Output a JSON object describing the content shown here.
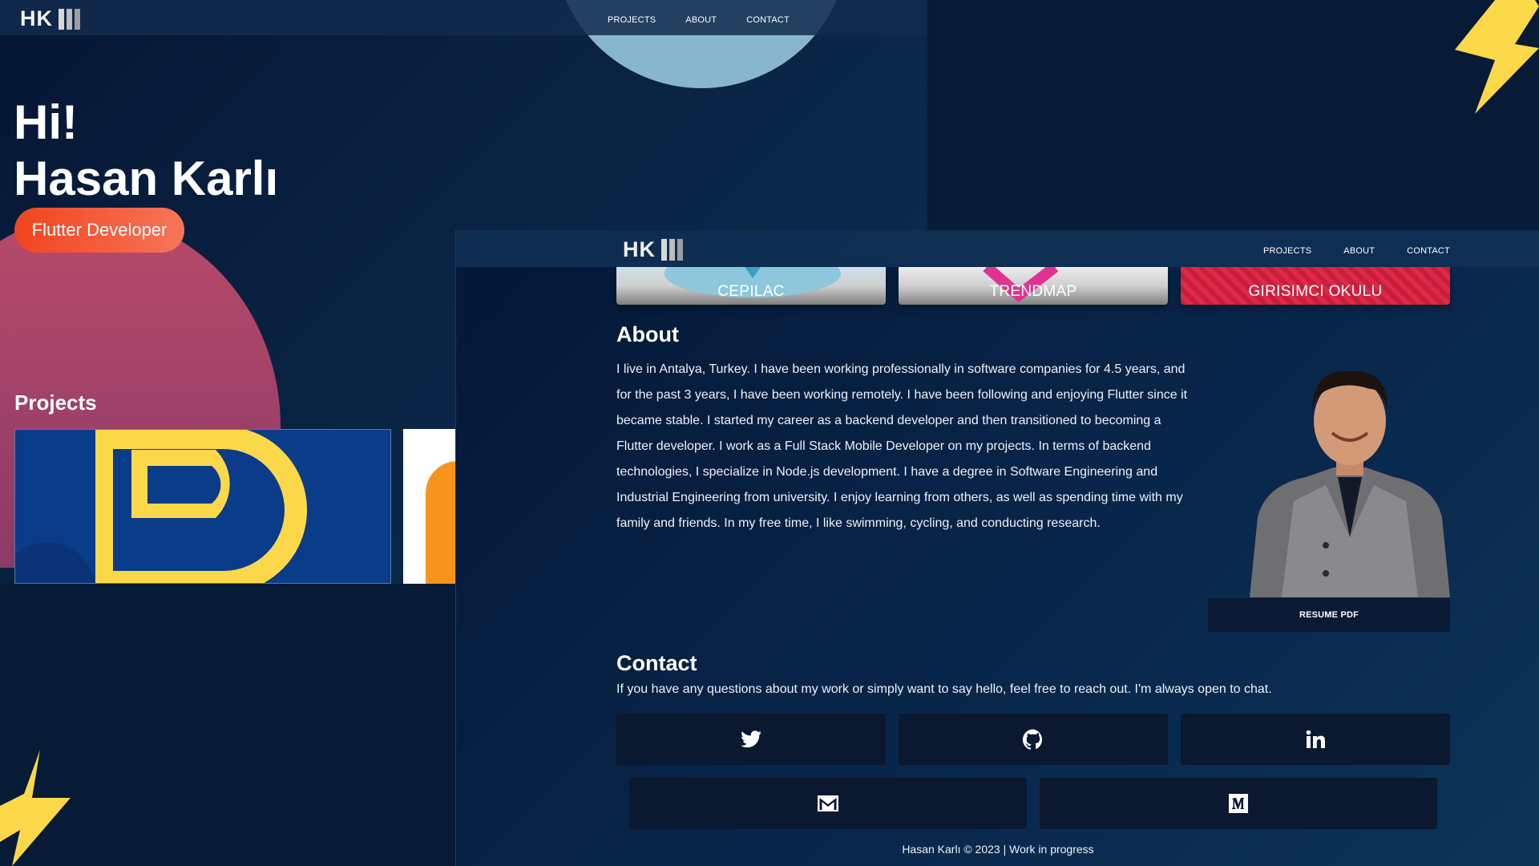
{
  "back_window": {
    "logo": {
      "text": "HK"
    },
    "nav": {
      "projects": "PROJECTS",
      "about": "ABOUT",
      "contact": "CONTACT"
    },
    "hero": {
      "greeting": "Hi!",
      "name": "Hasan Karlı",
      "role": "Flutter Developer"
    },
    "projects_heading": "Projects"
  },
  "front_window": {
    "logo": {
      "text": "HK"
    },
    "nav": {
      "projects": "PROJECTS",
      "about": "ABOUT",
      "contact": "CONTACT"
    },
    "project_cards": [
      {
        "label": "CEPILAC"
      },
      {
        "label": "TRENDMAP"
      },
      {
        "label": "GIRISIMCI OKULU"
      }
    ],
    "about": {
      "heading": "About",
      "text": "I live in Antalya, Turkey. I have been working professionally in software companies for 4.5 years, and for the past 3 years, I have been working remotely. I have been following and enjoying Flutter since it became stable. I started my career as a backend developer and then transitioned to becoming a Flutter developer. I work as a Full Stack Mobile Developer on my projects. In terms of backend technologies, I specialize in Node.js development. I have a degree in Software Engineering and Industrial Engineering from university. I enjoy learning from others, as well as spending time with my family and friends. In my free time, I like swimming, cycling, and conducting research.",
      "resume_button": "RESUME PDF"
    },
    "contact": {
      "heading": "Contact",
      "text": "If you have any questions about my work or simply want to say hello, feel free to reach out. I'm always open to chat.",
      "links": [
        {
          "icon": "twitter-icon"
        },
        {
          "icon": "github-icon"
        },
        {
          "icon": "linkedin-icon"
        },
        {
          "icon": "mail-icon"
        },
        {
          "icon": "medium-icon"
        }
      ]
    },
    "footer": "Hasan Karlı © 2023 | Work in progress"
  },
  "colors": {
    "background": "#071a36",
    "accent_orange": "#f1441f",
    "bolt_yellow": "#fbd84a",
    "moon": "#89b6cf",
    "blob": "#b84a6a"
  }
}
